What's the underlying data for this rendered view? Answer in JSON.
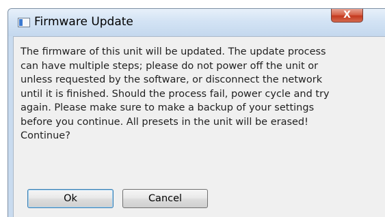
{
  "window": {
    "title": "Firmware Update",
    "close_label": "X"
  },
  "message": {
    "lines": [
      "The firmware of this unit will be updated. The update process",
      "can have multiple steps; please do not power off the unit or",
      "unless requested by the software, or disconnect the network",
      "until it is finished. Should the process fail, power cycle and try",
      "again. Please make sure to make a backup of your settings",
      "before you continue. All presets in the unit will be erased!",
      "Continue?"
    ]
  },
  "buttons": {
    "ok_label": "Ok",
    "cancel_label": "Cancel"
  },
  "colors": {
    "titlebar": "#d3e3f4",
    "close_button": "#c4391f",
    "dialog_background": "#f0f0f0",
    "default_button_border": "#3c7fb1"
  },
  "icons": {
    "app_icon": "window-icon",
    "close_icon": "close-icon"
  }
}
